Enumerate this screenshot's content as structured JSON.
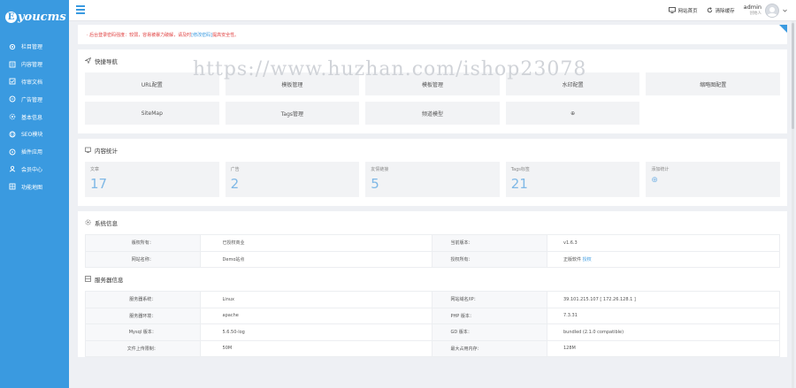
{
  "logo": {
    "mark": "E",
    "text": "youcms"
  },
  "sidebar": {
    "items": [
      {
        "label": "栏目管理",
        "icon": "gear-icon"
      },
      {
        "label": "内容管理",
        "icon": "document-icon"
      },
      {
        "label": "待审文档",
        "icon": "document-check-icon"
      },
      {
        "label": "广告管理",
        "icon": "megaphone-icon"
      },
      {
        "label": "基本信息",
        "icon": "settings-icon"
      },
      {
        "label": "SEO模块",
        "icon": "globe-icon"
      },
      {
        "label": "插件应用",
        "icon": "plugin-icon"
      },
      {
        "label": "会员中心",
        "icon": "user-icon"
      },
      {
        "label": "功能地图",
        "icon": "map-icon"
      }
    ]
  },
  "topbar": {
    "site_home": "网站首页",
    "clear_cache": "清除缓存",
    "admin_name": "admin",
    "admin_role": "创始人"
  },
  "notice": {
    "text": "· 后台登录密码强度：较弱，容易被暴力破解，请及时",
    "link": "[修改密码]",
    "suffix": "提高安全性。"
  },
  "watermark": "https://www.huzhan.com/ishop23078",
  "quick_nav": {
    "title": "快捷导航",
    "items": [
      "URL配置",
      "模板管理",
      "模板管理",
      "水印配置",
      "缩略图配置",
      "SiteMap",
      "Tags管理",
      "频道模型",
      "⊕"
    ]
  },
  "stats": {
    "title": "内容统计",
    "items": [
      {
        "label": "文章",
        "value": "17"
      },
      {
        "label": "广告",
        "value": "2"
      },
      {
        "label": "友情链接",
        "value": "5"
      },
      {
        "label": "Tags标签",
        "value": "21"
      },
      {
        "label": "添加统计",
        "value": "⊕"
      }
    ]
  },
  "system_info": {
    "title": "系统信息",
    "rows": [
      {
        "k1": "版权所有：",
        "v1": "已授权商业",
        "k2": "当前版本：",
        "v2": "v1.6.3",
        "v2_link": ""
      },
      {
        "k1": "网站名称：",
        "v1": "Demo站点",
        "k2": "授权所有：",
        "v2": "正版软件",
        "v2_link": "授权"
      }
    ]
  },
  "server_info": {
    "title": "服务器信息",
    "rows": [
      {
        "k1": "服务器系统：",
        "v1": "Linux",
        "k2": "网站域名/IP：",
        "v2": "39.101.215.107 [ 172.26.128.1 ]"
      },
      {
        "k1": "服务器环境：",
        "v1": "apache",
        "k2": "PHP 版本：",
        "v2": "7.3.31"
      },
      {
        "k1": "Mysql 版本：",
        "v1": "5.6.50-log",
        "k2": "GD 版本：",
        "v2": "bundled (2.1.0 compatible)"
      },
      {
        "k1": "文件上传限制：",
        "v1": "50M",
        "k2": "最大占用内存：",
        "v2": "128M"
      }
    ]
  }
}
